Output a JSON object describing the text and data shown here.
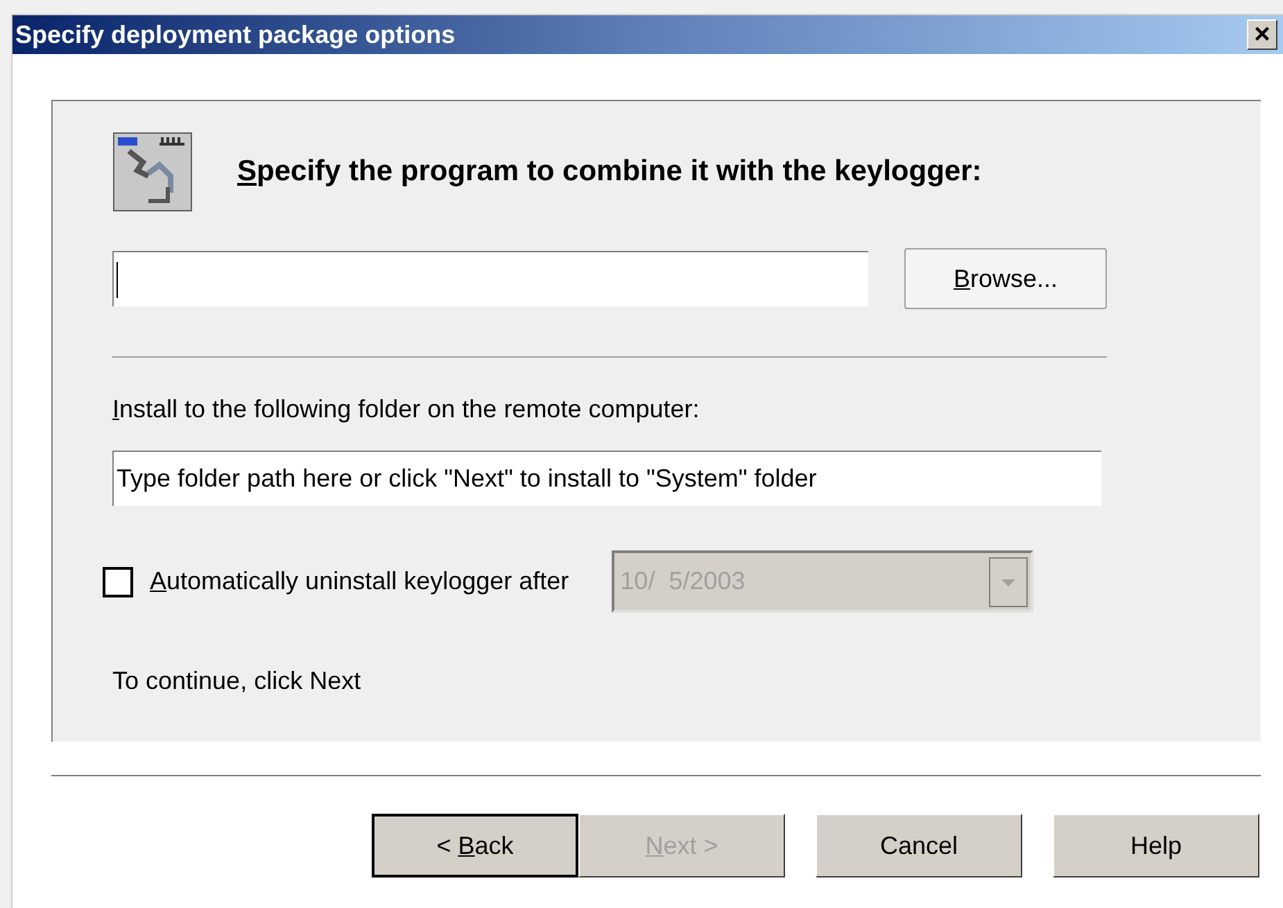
{
  "window": {
    "title": "Specify deployment package options",
    "close": "×"
  },
  "program": {
    "heading": {
      "key": "S",
      "post": "pecify the program to combine it with the keylogger:"
    },
    "browse": {
      "key": "B",
      "post": "rowse..."
    }
  },
  "folder": {
    "label": {
      "key": "I",
      "post": "nstall to the following folder on the remote computer:"
    },
    "value": "Type folder path here or click \"Next\" to install to \"System\" folder"
  },
  "auto_uninstall": {
    "checked": false,
    "label": {
      "key": "A",
      "post": "utomatically uninstall keylogger after"
    },
    "date": "10/  5/2003",
    "disabled": true
  },
  "hint": "To continue, click Next",
  "buttons": [
    {
      "label": {
        "pre": "< ",
        "key": "B",
        "post": "ack"
      },
      "disabled": false,
      "default": true
    },
    {
      "label": {
        "key": "N",
        "post": "ext >"
      },
      "disabled": true,
      "default": false
    },
    {
      "label": {
        "post": "Cancel"
      },
      "disabled": false,
      "default": false
    },
    {
      "label": {
        "post": "Help"
      },
      "disabled": false,
      "default": false
    }
  ]
}
